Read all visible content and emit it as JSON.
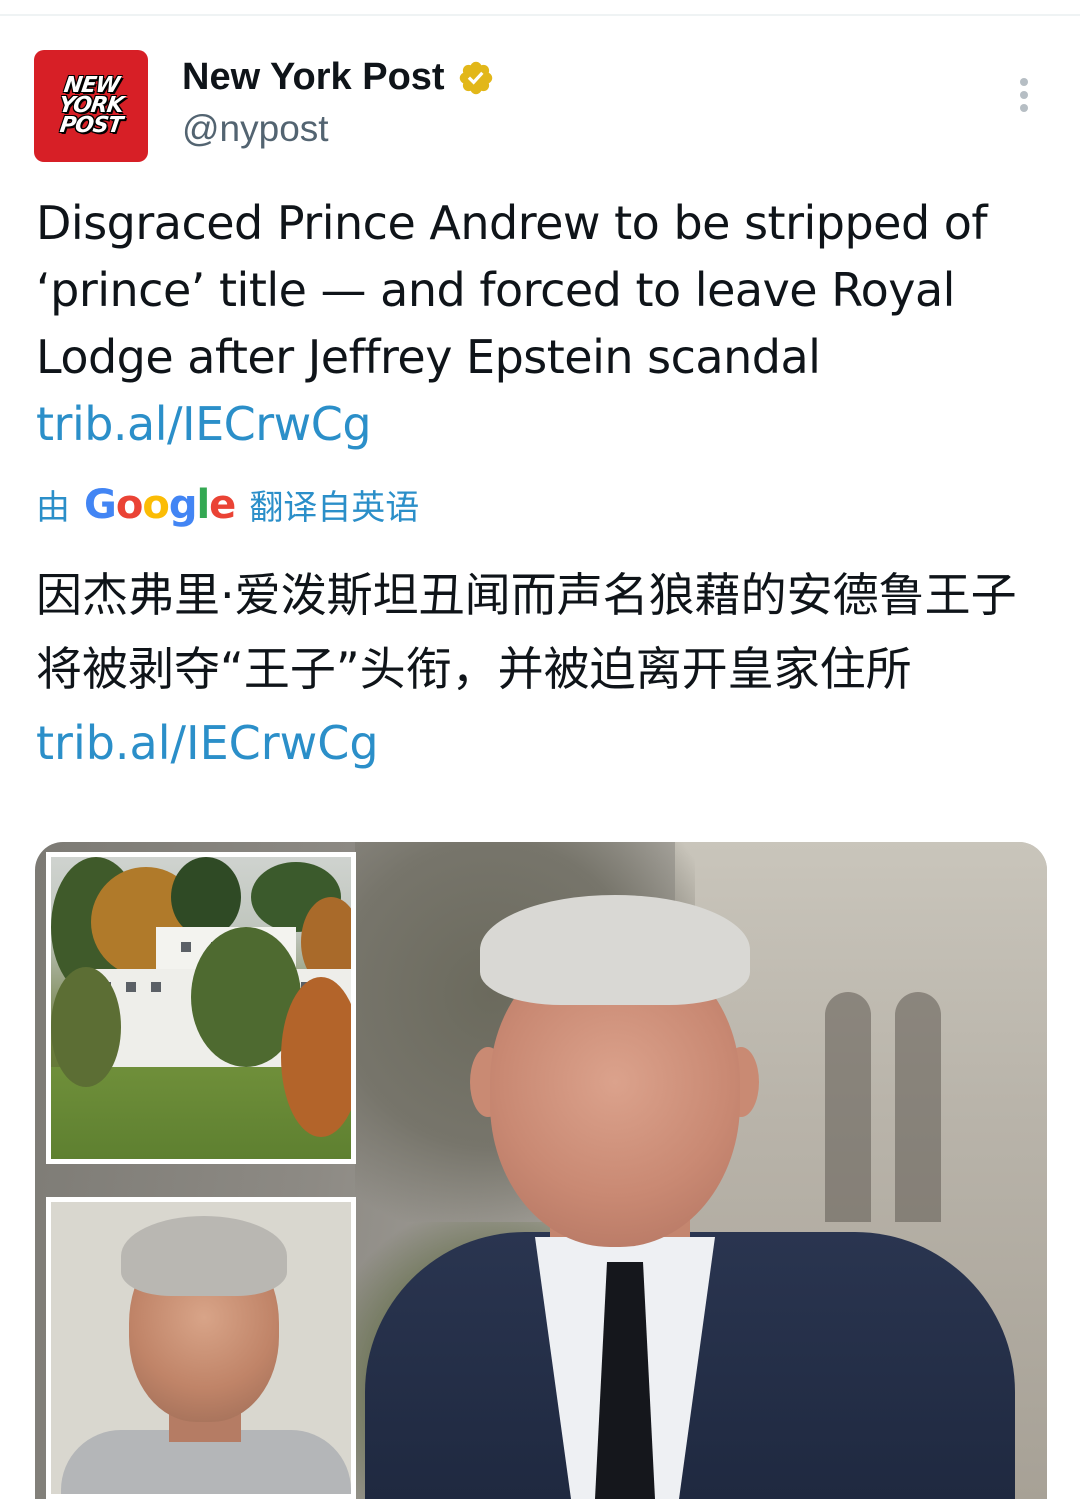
{
  "account": {
    "avatar_text": [
      "NEW",
      "YORK",
      "POST"
    ],
    "display_name": "New York Post",
    "handle": "@nypost",
    "verified": true
  },
  "tweet": {
    "text": "Disgraced Prince Andrew to be stripped of ‘prince’ title — and forced to leave Royal Lodge after Jeffrey Epstein scandal ",
    "link": "trib.al/IECrwCg"
  },
  "translation": {
    "by_label": "由",
    "provider": "Google",
    "suffix_label": "翻译自英语",
    "text": "因杰弗里·爱泼斯坦丑闻而声名狼藉的安德鲁王子将被剥夺“王子”头衔，并被迫离开皇家住所",
    "link": "trib.al/IECrwCg"
  },
  "colors": {
    "link": "#2b8fc9",
    "brand_red": "#d71f26",
    "verified_gold": "#e2b719"
  },
  "icons": {
    "verified": "verified-badge-icon",
    "more": "more-options-icon"
  }
}
